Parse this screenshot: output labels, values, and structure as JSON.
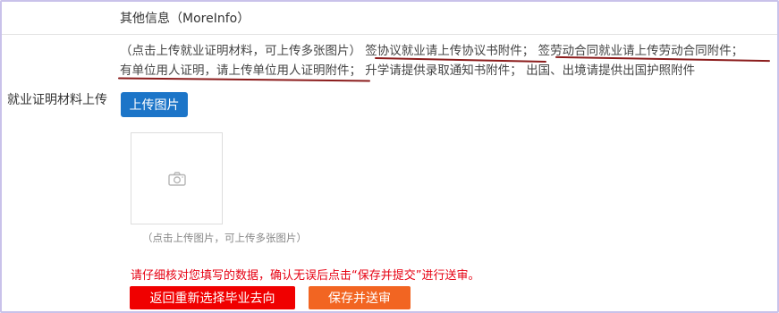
{
  "section": {
    "title": "其他信息（MoreInfo）"
  },
  "form": {
    "upload_label": "就业证明材料上传",
    "instructions": {
      "part1": "（点击上传就业证明材料，可上传多张图片）",
      "part2": "签协议就业请上传协议书附件；",
      "part3": "签劳动合同就业请上传劳动合同附件；",
      "part4": "有单位用人证明，请上传单位用人证明附件；",
      "part5": "升学请提供录取通知书附件；",
      "part6": "出国、出境请提供出国护照附件"
    },
    "upload_button": "上传图片",
    "image_caption": "（点击上传图片，可上传多张图片）"
  },
  "footer": {
    "notice": "请仔细核对您填写的数据，确认无误后点击“保存并提交”进行送审。",
    "back_button": "返回重新选择毕业去向",
    "save_button": "保存并送审"
  },
  "colors": {
    "upload_button": "#1c75c8",
    "back_button": "#f00000",
    "save_button": "#f26522",
    "notice_text": "#e60012",
    "underline_annotation": "#8b1c1c"
  },
  "icons": {
    "placeholder": "camera-icon"
  }
}
